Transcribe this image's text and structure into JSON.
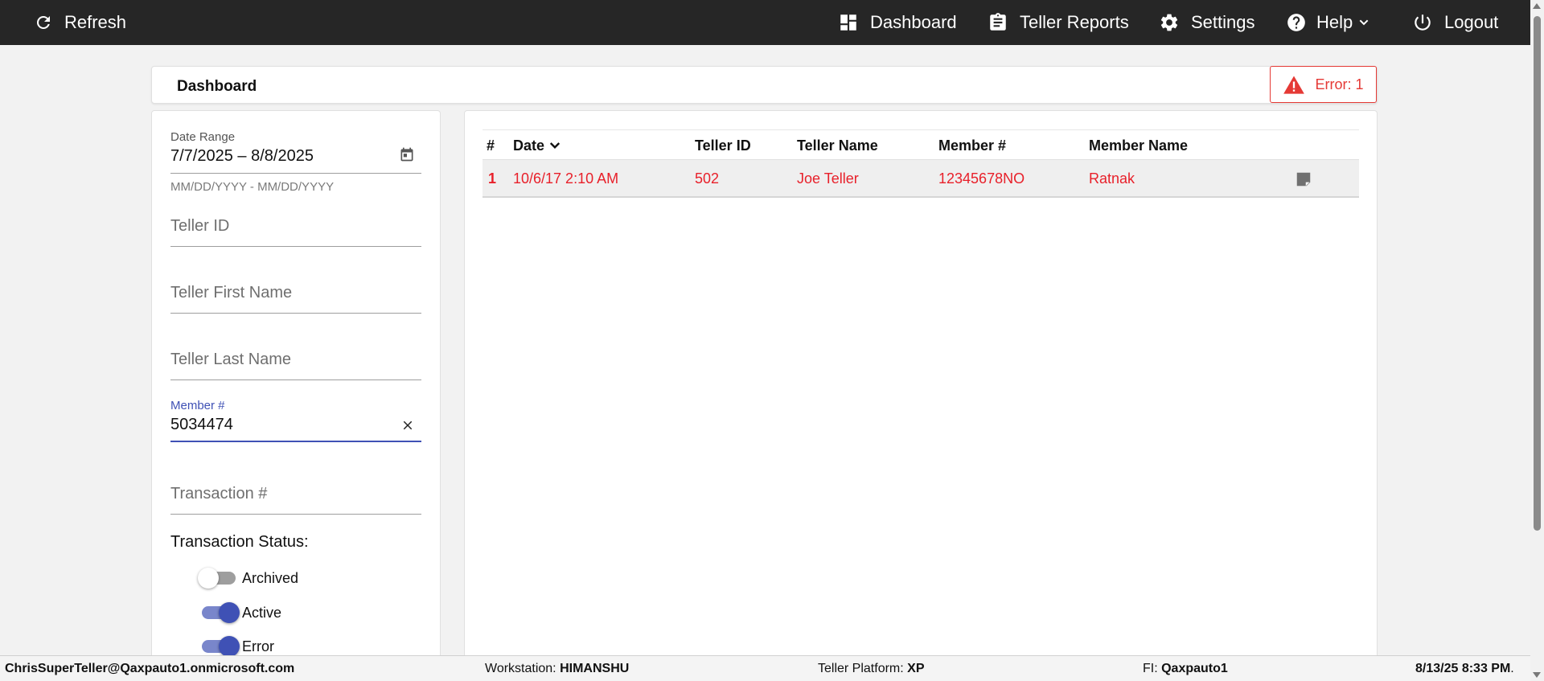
{
  "nav": {
    "refresh": "Refresh",
    "dashboard": "Dashboard",
    "teller_reports": "Teller Reports",
    "settings": "Settings",
    "help": "Help",
    "logout": "Logout"
  },
  "header": {
    "title": "Dashboard",
    "error_badge": "Error: 1"
  },
  "filters": {
    "date_range_label": "Date Range",
    "date_range_value": "7/7/2025 – 8/8/2025",
    "date_range_hint": "MM/DD/YYYY - MM/DD/YYYY",
    "teller_id_placeholder": "Teller ID",
    "teller_first_name_placeholder": "Teller First Name",
    "teller_last_name_placeholder": "Teller Last Name",
    "member_label": "Member #",
    "member_value": "5034474",
    "transaction_placeholder": "Transaction #",
    "status_label": "Transaction Status:",
    "toggles": [
      {
        "label": "Archived",
        "on": false
      },
      {
        "label": "Active",
        "on": true
      },
      {
        "label": "Error",
        "on": true
      }
    ]
  },
  "table": {
    "headers": [
      "#",
      "Date",
      "Teller ID",
      "Teller Name",
      "Member #",
      "Member Name"
    ],
    "rows": [
      {
        "num": "1",
        "date": "10/6/17 2:10 AM",
        "teller_id": "502",
        "teller_name": "Joe Teller",
        "member_num": "12345678NO",
        "member_name": "Ratnak"
      }
    ]
  },
  "statusbar": {
    "user": "ChrisSuperTeller@Qaxpauto1.onmicrosoft.com",
    "workstation_label": "Workstation: ",
    "workstation": "HIMANSHU",
    "platform_label": "Teller Platform: ",
    "platform": "XP",
    "fi_label": "FI: ",
    "fi": "Qaxpauto1",
    "datetime": "8/13/25 8:33 PM",
    "datetime_suffix": "."
  },
  "colors": {
    "topbar": "#262626",
    "accent": "#3f51b5",
    "error": "#e53935",
    "row_text": "#e8202a"
  }
}
